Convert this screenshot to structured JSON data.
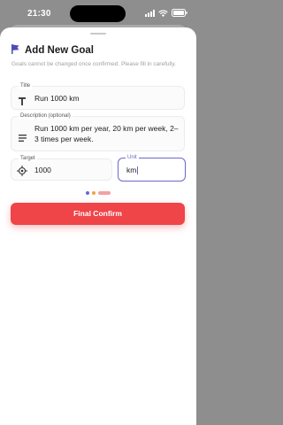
{
  "status_bar": {
    "time": "21:30"
  },
  "header": {
    "title": "Add New Goal"
  },
  "hint": "Goals cannot be changed once confirmed. Please fill in carefully.",
  "fields": {
    "title": {
      "label": "Title",
      "value": "Run 1000 km"
    },
    "description": {
      "label": "Description (optional)",
      "value": "Run 1000 km per year, 20 km per week, 2–3 times per week."
    },
    "target": {
      "label": "Target",
      "value": "1000"
    },
    "unit": {
      "label": "Unit",
      "value": "km"
    }
  },
  "pager": {
    "pages": 3,
    "active": 3
  },
  "confirm_button": {
    "label": "Final Confirm"
  },
  "colors": {
    "accent": "#6a68c9",
    "primary_button": "#ef4448",
    "dot_1": "#6a68c9",
    "dot_2": "#f0a33a",
    "dot_active": "#f4a0a2"
  }
}
